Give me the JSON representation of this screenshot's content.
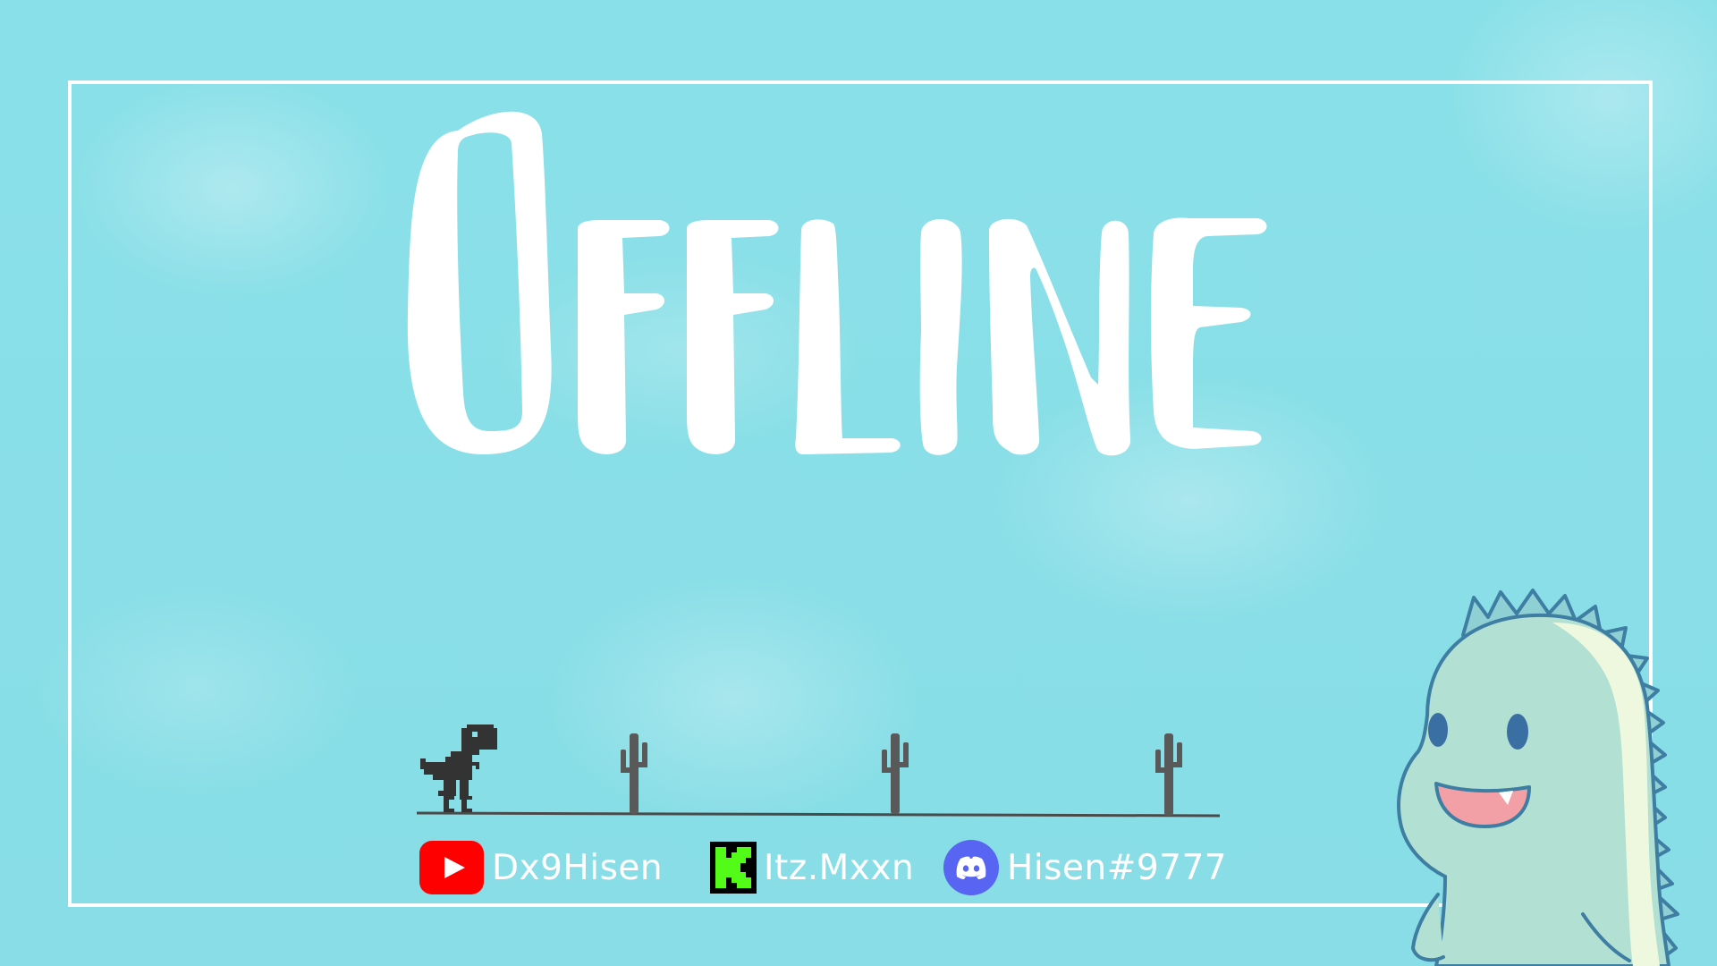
{
  "screen": {
    "title": "Offline",
    "background_color": "#8adfe7",
    "frame_color": "#ffffff"
  },
  "socials": [
    {
      "platform": "youtube",
      "icon": "youtube-icon",
      "handle": "Dx9Hisen",
      "icon_color": "#ff0000"
    },
    {
      "platform": "kick",
      "icon": "kick-icon",
      "handle": "Itz.Mxxn",
      "icon_color": "#53fc18"
    },
    {
      "platform": "discord",
      "icon": "discord-icon",
      "handle": "Hisen#9777",
      "icon_color": "#5865f2"
    }
  ],
  "scene": {
    "runner": "trex-icon",
    "obstacles": [
      "cactus-icon",
      "cactus-icon",
      "cactus-icon"
    ]
  },
  "mascot": {
    "icon": "dinosaur-mascot-icon",
    "body_color": "#b2e0d2",
    "spike_color": "#8ed0d4",
    "outline_color": "#3f7ea3"
  }
}
